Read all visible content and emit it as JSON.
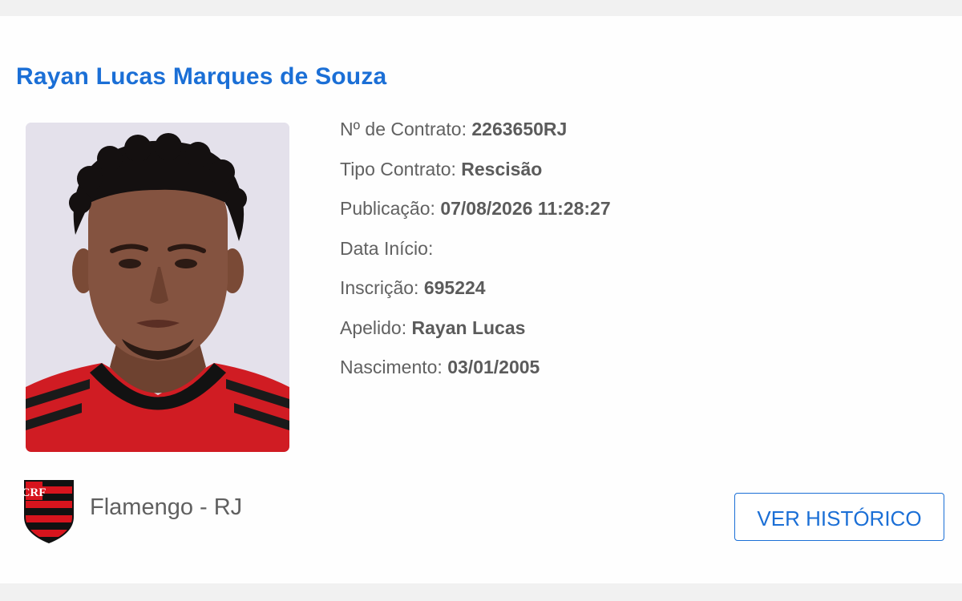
{
  "player": {
    "full_name": "Rayan Lucas Marques de Souza",
    "photo_alt": "Foto do atleta"
  },
  "fields": [
    {
      "label": "Nº de Contrato:",
      "value": "2263650RJ"
    },
    {
      "label": "Tipo Contrato:",
      "value": "Rescisão"
    },
    {
      "label": "Publicação:",
      "value": "07/08/2026 11:28:27"
    },
    {
      "label": "Data Início:",
      "value": ""
    },
    {
      "label": "Inscrição:",
      "value": "695224"
    },
    {
      "label": "Apelido:",
      "value": "Rayan Lucas"
    },
    {
      "label": "Nascimento:",
      "value": "03/01/2005"
    }
  ],
  "club": {
    "name": "Flamengo - RJ",
    "crest_icon": "flamengo-crest-icon",
    "colors": {
      "red": "#d7141d",
      "black": "#111111"
    }
  },
  "actions": {
    "history_button": "VER HISTÓRICO"
  },
  "theme": {
    "accent": "#1b6fd6",
    "text": "#616161",
    "background": "#f1f1f1"
  }
}
